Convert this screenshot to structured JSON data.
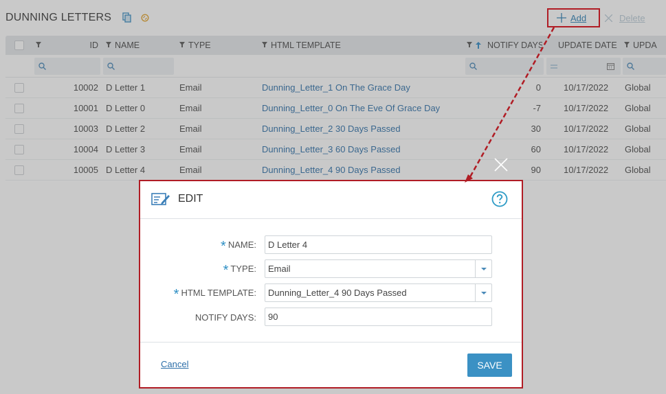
{
  "page": {
    "title": "DUNNING LETTERS",
    "add_label": "Add",
    "delete_label": "Delete"
  },
  "table": {
    "columns": [
      "ID",
      "NAME",
      "TYPE",
      "HTML TEMPLATE",
      "NOTIFY DAYS",
      "UPDATE DATE",
      "UPDA"
    ],
    "rows": [
      {
        "id": "10002",
        "name": "D Letter 1",
        "type": "Email",
        "template": "Dunning_Letter_1 On The Grace Day",
        "notify_days": "0",
        "update_date": "10/17/2022",
        "updated_by": "Global"
      },
      {
        "id": "10001",
        "name": "D Letter 0",
        "type": "Email",
        "template": "Dunning_Letter_0 On The Eve Of Grace Day",
        "notify_days": "-7",
        "update_date": "10/17/2022",
        "updated_by": "Global"
      },
      {
        "id": "10003",
        "name": "D Letter 2",
        "type": "Email",
        "template": "Dunning_Letter_2 30 Days Passed",
        "notify_days": "30",
        "update_date": "10/17/2022",
        "updated_by": "Global"
      },
      {
        "id": "10004",
        "name": "D Letter 3",
        "type": "Email",
        "template": "Dunning_Letter_3 60 Days Passed",
        "notify_days": "60",
        "update_date": "10/17/2022",
        "updated_by": "Global"
      },
      {
        "id": "10005",
        "name": "D Letter 4",
        "type": "Email",
        "template": "Dunning_Letter_4 90 Days Passed",
        "notify_days": "90",
        "update_date": "10/17/2022",
        "updated_by": "Global"
      }
    ]
  },
  "dialog": {
    "title": "EDIT",
    "fields": {
      "name_label": "NAME:",
      "name_value": "D Letter 4",
      "type_label": "TYPE:",
      "type_value": "Email",
      "template_label": "HTML TEMPLATE:",
      "template_value": "Dunning_Letter_4 90 Days Passed",
      "notify_label": "NOTIFY DAYS:",
      "notify_value": "90"
    },
    "cancel_label": "Cancel",
    "save_label": "SAVE"
  },
  "colors": {
    "accent": "#3b91c4",
    "link": "#2b6ea8",
    "annotation": "#b01c24"
  }
}
